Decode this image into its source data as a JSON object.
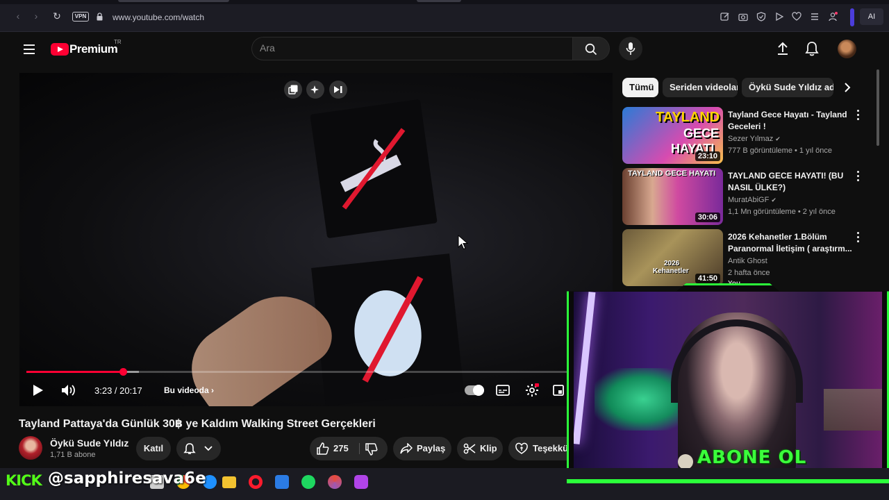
{
  "browser": {
    "url": "www.youtube.com/watch",
    "vpn_label": "VPN",
    "ai_label": "AI",
    "back_icon": "back-arrow-icon",
    "reload_icon": "reload-icon"
  },
  "masthead": {
    "logo_text": "Premium",
    "country_code": "TR",
    "search_placeholder": "Ara"
  },
  "player": {
    "time": "3:23 / 20:17",
    "chapter_label": "Bu videoda",
    "progress": 0.167
  },
  "video": {
    "title": "Tayland Pattaya'da Günlük 30฿ ye Kaldım Walking Street Gerçekleri",
    "channel_name": "Öykü Sude Yıldız",
    "subscribers": "1,71 B abone",
    "join_label": "Katıl",
    "like_count": "275",
    "share_label": "Paylaş",
    "clip_label": "Klip",
    "thanks_label": "Teşekkü"
  },
  "sidebar": {
    "chips": [
      "Tümü",
      "Seriden videolar",
      "Öykü Sude Yıldız adl"
    ],
    "recommendations": [
      {
        "title": "Tayland Gece Hayatı - Tayland Geceleri !",
        "channel": "Sezer Yılmaz",
        "meta": "777 B görüntüleme • 1 yıl önce",
        "duration": "23:10",
        "thumb_text1": "TAYLAND",
        "thumb_text2": "GECE",
        "thumb_text3": "HAYATI"
      },
      {
        "title": "TAYLAND GECE HAYATI! (BU NASIL ÜLKE?)",
        "channel": "MuratAbiGF",
        "meta": "1,1 Mn görüntüleme • 2 yıl önce",
        "duration": "30:06",
        "thumb_text1": "TAYLAND GECE HAYATI"
      },
      {
        "title": "2026 Kehanetler 1.Bölüm Paranormal İletişim ( araştırm...",
        "channel": "Antik Ghost",
        "meta": "2 hafta önce",
        "duration": "41:50",
        "thumb_text1": "2026",
        "thumb_text2": "Kehanetler",
        "badge": "You"
      }
    ]
  },
  "overlay": {
    "abone_text": "ABONE OL",
    "kick_logo": "KICK",
    "kick_handle": "@sapphiresava6e"
  }
}
